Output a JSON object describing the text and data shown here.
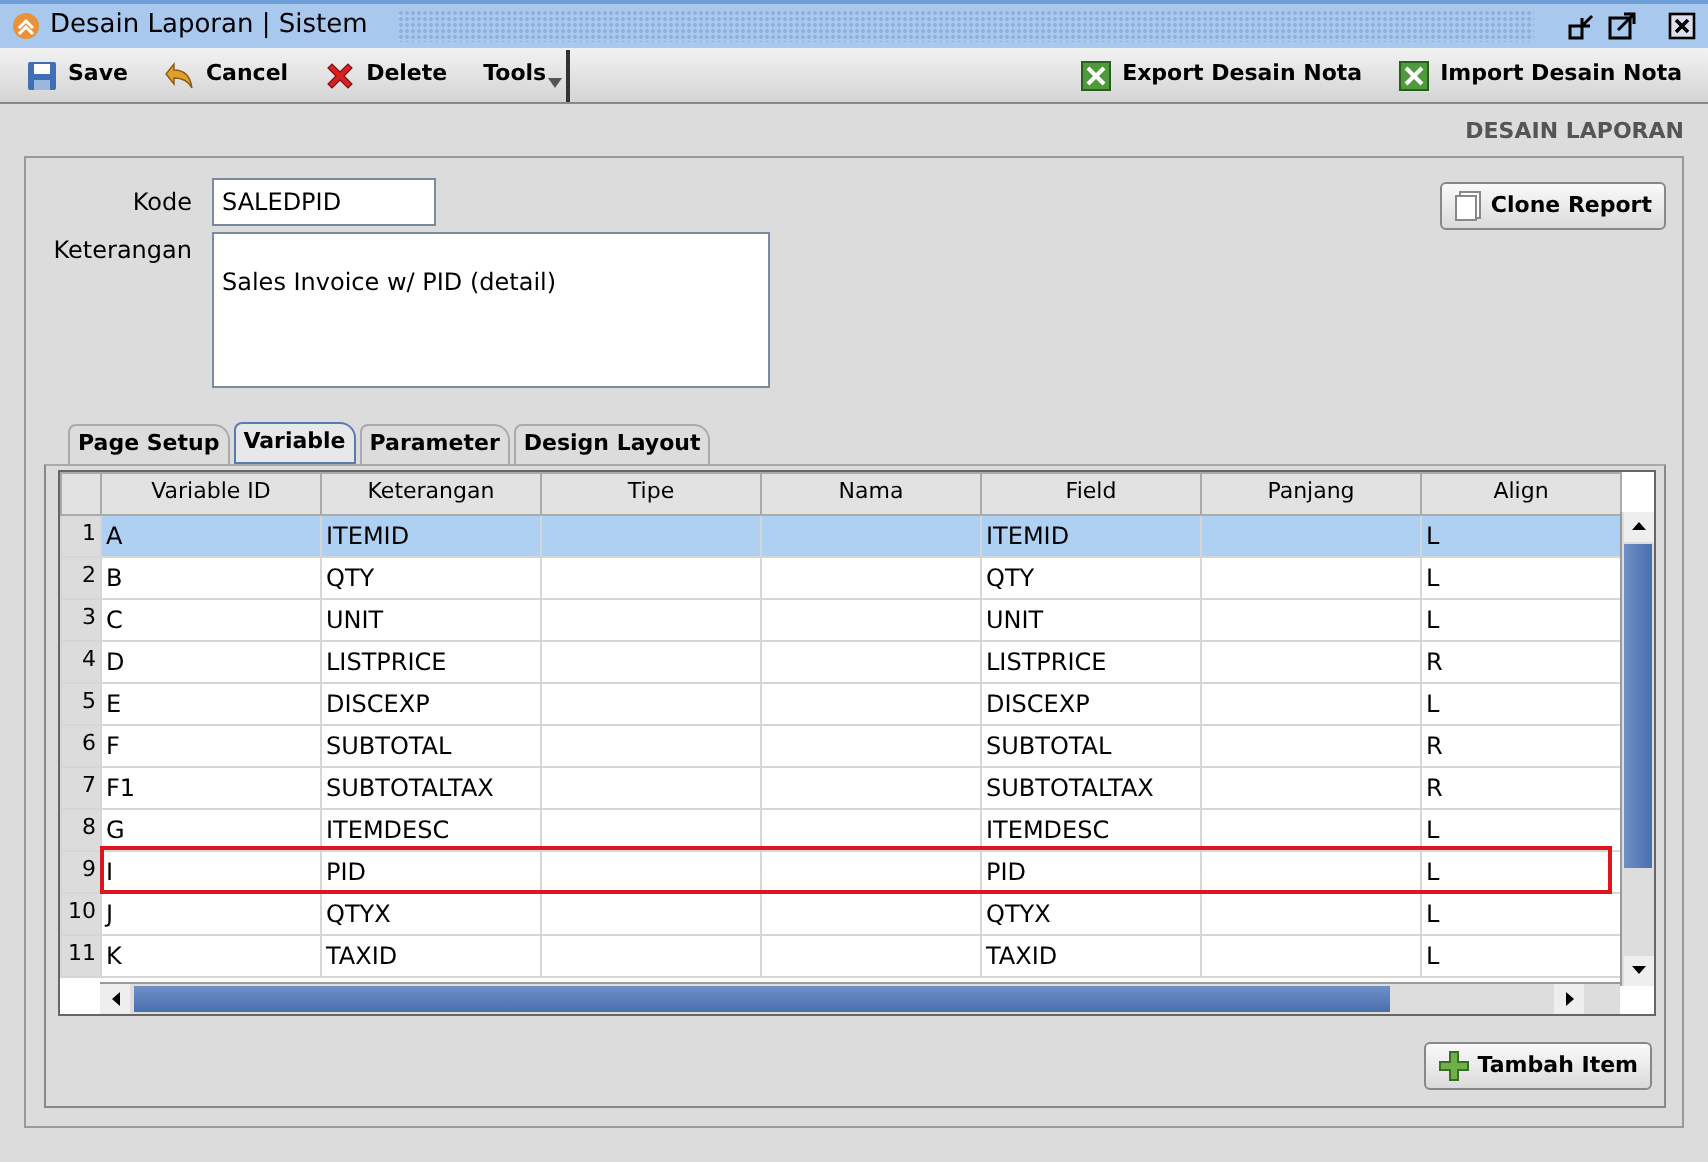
{
  "window": {
    "title": "Desain Laporan | Sistem"
  },
  "toolbar": {
    "left": [
      {
        "label": "Save",
        "kind": "save"
      },
      {
        "label": "Cancel",
        "kind": "cancel"
      },
      {
        "label": "Delete",
        "kind": "delete"
      },
      {
        "label": "Tools",
        "kind": "menu"
      }
    ],
    "right": [
      {
        "label": "Export Desain Nota",
        "kind": "excel"
      },
      {
        "label": "Import Desain Nota",
        "kind": "excel"
      }
    ]
  },
  "section_title": "DESAIN LAPORAN",
  "form": {
    "kode_label": "Kode",
    "kode_value": "SALEDPID",
    "keterangan_label": "Keterangan",
    "keterangan_value": "Sales Invoice w/ PID (detail)",
    "clone_button": "Clone Report"
  },
  "tabs": [
    {
      "label": "Page Setup",
      "selected": false
    },
    {
      "label": "Variable",
      "selected": true
    },
    {
      "label": "Parameter",
      "selected": false
    },
    {
      "label": "Design Layout",
      "selected": false
    }
  ],
  "table": {
    "columns": [
      "Variable ID",
      "Keterangan",
      "Tipe",
      "Nama",
      "Field",
      "Panjang",
      "Align"
    ],
    "rows": [
      {
        "num": "1",
        "cells": [
          "A",
          "ITEMID",
          "",
          "",
          "ITEMID",
          "",
          "L"
        ],
        "selected": true,
        "highlighted": false
      },
      {
        "num": "2",
        "cells": [
          "B",
          "QTY",
          "",
          "",
          "QTY",
          "",
          "L"
        ],
        "selected": false,
        "highlighted": false
      },
      {
        "num": "3",
        "cells": [
          "C",
          "UNIT",
          "",
          "",
          "UNIT",
          "",
          "L"
        ],
        "selected": false,
        "highlighted": false
      },
      {
        "num": "4",
        "cells": [
          "D",
          "LISTPRICE",
          "",
          "",
          "LISTPRICE",
          "",
          "R"
        ],
        "selected": false,
        "highlighted": false
      },
      {
        "num": "5",
        "cells": [
          "E",
          "DISCEXP",
          "",
          "",
          "DISCEXP",
          "",
          "L"
        ],
        "selected": false,
        "highlighted": false
      },
      {
        "num": "6",
        "cells": [
          "F",
          "SUBTOTAL",
          "",
          "",
          "SUBTOTAL",
          "",
          "R"
        ],
        "selected": false,
        "highlighted": false
      },
      {
        "num": "7",
        "cells": [
          "F1",
          "SUBTOTALTAX",
          "",
          "",
          "SUBTOTALTAX",
          "",
          "R"
        ],
        "selected": false,
        "highlighted": false
      },
      {
        "num": "8",
        "cells": [
          "G",
          "ITEMDESC",
          "",
          "",
          "ITEMDESC",
          "",
          "L"
        ],
        "selected": false,
        "highlighted": false
      },
      {
        "num": "9",
        "cells": [
          "I",
          "PID",
          "",
          "",
          "PID",
          "",
          "L"
        ],
        "selected": false,
        "highlighted": true
      },
      {
        "num": "10",
        "cells": [
          "J",
          "QTYX",
          "",
          "",
          "QTYX",
          "",
          "L"
        ],
        "selected": false,
        "highlighted": false
      },
      {
        "num": "11",
        "cells": [
          "K",
          "TAXID",
          "",
          "",
          "TAXID",
          "",
          "L"
        ],
        "selected": false,
        "highlighted": false
      }
    ]
  },
  "add_button": "Tambah Item"
}
